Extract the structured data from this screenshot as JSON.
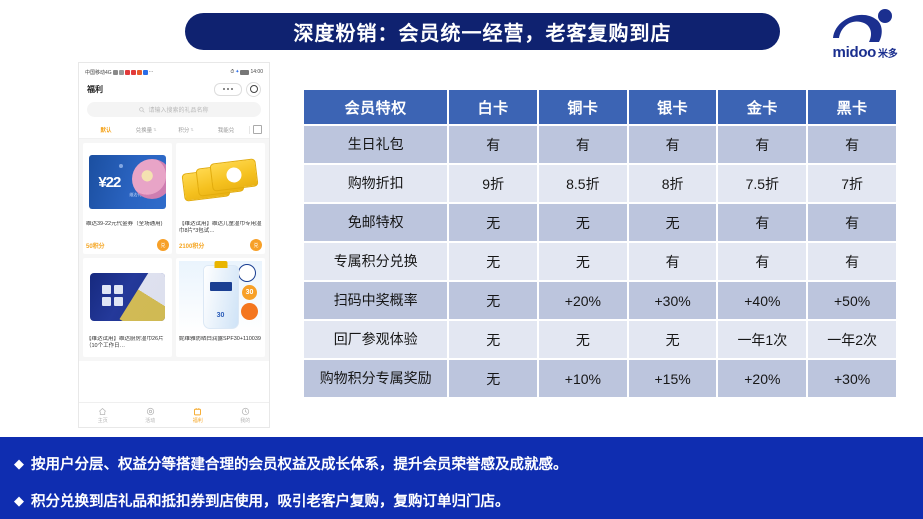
{
  "slide": {
    "title": "深度粉销：会员统一经营，老客复购到店",
    "title_bg": "#0f2270",
    "band_bg": "#0f2db0",
    "table_header_bg": "#3c64b4",
    "row_odd_bg": "#bcc5dd",
    "row_even_bg": "#e3e7f2",
    "accent_orange": "#f5a623"
  },
  "logo": {
    "name": "midoo",
    "cn": "米多",
    "color": "#1b2f8f"
  },
  "phone": {
    "status": {
      "carrier": "中国移动4G",
      "time": "14:00"
    },
    "page_title": "福利",
    "search_placeholder": "请输入搜索的礼品名称",
    "tabs": [
      {
        "label": "默认",
        "active": true,
        "sortable": false
      },
      {
        "label": "兑换量",
        "active": false,
        "sortable": true
      },
      {
        "label": "积分",
        "active": false,
        "sortable": true
      },
      {
        "label": "我能兑",
        "active": false,
        "sortable": false
      }
    ],
    "cards": [
      {
        "name": "维达39-22元代金券（全场通用)",
        "points": "50积分",
        "amount": "¥22",
        "amount_sub": "维达代金券"
      },
      {
        "name": "【维达试用】维达儿童湿巾专用湿巾8片*3包试…",
        "points": "2100积分"
      },
      {
        "name": "【维达试用】维达厨房湿巾26片（10个工作日…",
        "points": ""
      },
      {
        "name": "妮维雅防晒白润露SPF30+110039",
        "points": "",
        "spf": "30",
        "badge": "30"
      }
    ],
    "nav": [
      {
        "label": "主页",
        "icon": "home-icon",
        "active": false
      },
      {
        "label": "活动",
        "icon": "activity-icon",
        "active": false
      },
      {
        "label": "福利",
        "icon": "gift-icon",
        "active": true
      },
      {
        "label": "我的",
        "icon": "profile-icon",
        "active": false
      }
    ]
  },
  "table": {
    "headers": [
      "会员特权",
      "白卡",
      "铜卡",
      "银卡",
      "金卡",
      "黑卡"
    ],
    "rows": [
      {
        "feature": "生日礼包",
        "values": [
          "有",
          "有",
          "有",
          "有",
          "有"
        ]
      },
      {
        "feature": "购物折扣",
        "values": [
          "9折",
          "8.5折",
          "8折",
          "7.5折",
          "7折"
        ]
      },
      {
        "feature": "免邮特权",
        "values": [
          "无",
          "无",
          "无",
          "有",
          "有"
        ]
      },
      {
        "feature": "专属积分兑换",
        "values": [
          "无",
          "无",
          "有",
          "有",
          "有"
        ]
      },
      {
        "feature": "扫码中奖概率",
        "values": [
          "无",
          "+20%",
          "+30%",
          "+40%",
          "+50%"
        ]
      },
      {
        "feature": "回厂参观体验",
        "values": [
          "无",
          "无",
          "无",
          "一年1次",
          "一年2次"
        ]
      },
      {
        "feature": "购物积分专属奖励",
        "values": [
          "无",
          "+10%",
          "+15%",
          "+20%",
          "+30%"
        ]
      }
    ]
  },
  "bullets": [
    "按用户分层、权益分等搭建合理的会员权益及成长体系，提升会员荣誉感及成就感。",
    "积分兑换到店礼品和抵扣券到店使用，吸引老客户复购，复购订单归门店。"
  ],
  "bullet_marker": "◆"
}
